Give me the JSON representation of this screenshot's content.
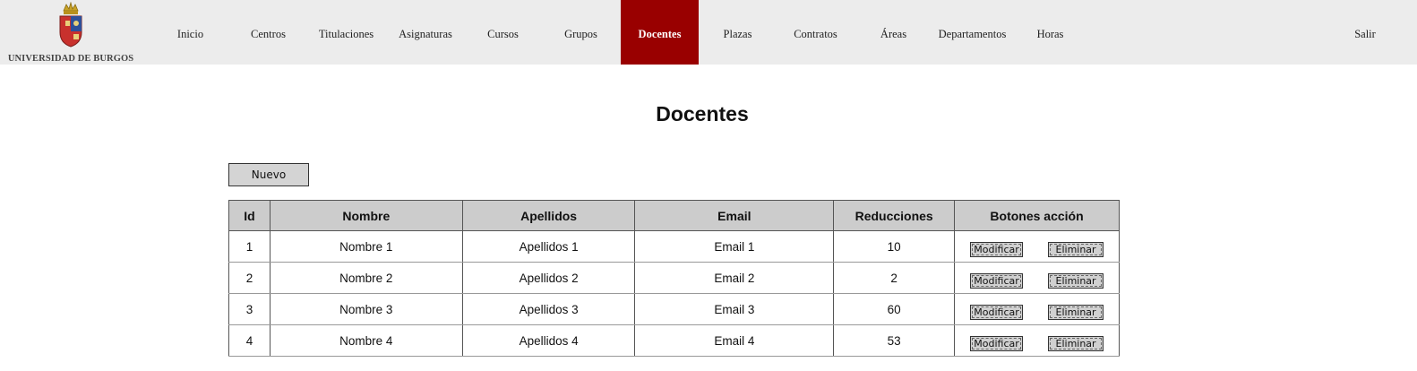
{
  "header": {
    "logo_text": "UNIVERSIDAD DE BURGOS",
    "nav": [
      "Inicio",
      "Centros",
      "Titulaciones",
      "Asignaturas",
      "Cursos",
      "Grupos",
      "Docentes",
      "Plazas",
      "Contratos",
      "Áreas",
      "Departamentos",
      "Horas"
    ],
    "active": "Docentes",
    "logout": "Salir"
  },
  "main": {
    "title": "Docentes",
    "new_button": "Nuevo",
    "columns": [
      "Id",
      "Nombre",
      "Apellidos",
      "Email",
      "Reducciones",
      "Botones acción"
    ],
    "rows": [
      [
        "1",
        "Nombre 1",
        "Apellidos 1",
        "Email 1",
        "10"
      ],
      [
        "2",
        "Nombre 2",
        "Apellidos 2",
        "Email 2",
        "2"
      ],
      [
        "3",
        "Nombre 3",
        "Apellidos 3",
        "Email 3",
        "60"
      ],
      [
        "4",
        "Nombre 4",
        "Apellidos 4",
        "Email 4",
        "53"
      ]
    ],
    "modify_label": "Modificar",
    "delete_label": "Eliminar"
  },
  "colors": {
    "accent": "#990000",
    "header_bg": "#ececec",
    "table_header_bg": "#cccccc"
  }
}
